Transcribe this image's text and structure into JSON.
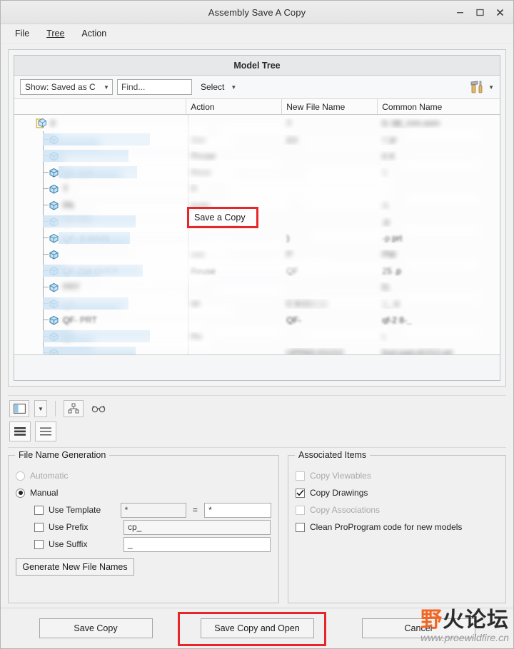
{
  "window": {
    "title": "Assembly Save A Copy",
    "controls": {
      "minimize": "minimize-icon",
      "maximize": "maximize-icon",
      "close": "close-icon"
    }
  },
  "menubar": {
    "items": [
      "File",
      "Tree",
      "Action"
    ]
  },
  "model_tree": {
    "header": "Model Tree",
    "toolbar": {
      "show_filter": "Show: Saved as C",
      "find_placeholder": "Find...",
      "select_label": "Select",
      "tools_icon": "hammer-screwdriver-icon"
    },
    "columns": [
      "",
      "Action",
      "New File Name",
      "Common Name"
    ],
    "rows": [
      {
        "name": "0",
        "action": "",
        "new_file_name": "2",
        "common_name": "0-  68_rnm.asm",
        "type": "assembly",
        "blurred": true
      },
      {
        "name": "",
        "action": "Sav",
        "new_file_name": "ZJ-",
        "common_name": "z      pr",
        "type": "part",
        "blurred": true
      },
      {
        "name": "",
        "action": "Reuse",
        "new_file_name": "",
        "common_name": "0          4",
        "type": "part",
        "blurred": true
      },
      {
        "name": "QF-  8-P",
        "action": "Reus",
        "new_file_name": "",
        "common_name": "1",
        "type": "part",
        "blurred": true
      },
      {
        "name": "T",
        "action": "R",
        "new_file_name": "",
        "common_name": "",
        "type": "part",
        "blurred": true
      },
      {
        "name": "PA",
        "action": "euse",
        "new_file_name": "",
        "common_name": "A",
        "type": "part",
        "blurred": true
      },
      {
        "name": "QF-255",
        "action": "Save a Copy",
        "new_file_name": "",
        "common_name": ".p",
        "type": "part",
        "blurred": true
      },
      {
        "name": "QF-  8-MAIN",
        "action": "",
        "new_file_name": ")",
        "common_name": "-p      prt",
        "type": "part",
        "blurred": false
      },
      {
        "name": "",
        "action": "use",
        "new_file_name": "P",
        "common_name": "PW",
        "type": "part",
        "blurred": true
      },
      {
        "name": "QF-258            OVER",
        "action": "Reuse",
        "new_file_name": "QF",
        "common_name": "25    .p",
        "type": "part",
        "blurred": false
      },
      {
        "name": "          PRT",
        "action": "",
        "new_file_name": "",
        "common_name": "D.",
        "type": "part",
        "blurred": true
      },
      {
        "name": "QF-",
        "action": "se",
        "new_file_name": "C   8-DECO",
        "common_name": "1_  rt",
        "type": "part",
        "blurred": true
      },
      {
        "name": "QF-             PRT",
        "action": "",
        "new_file_name": "QF-",
        "common_name": "qf-2  8-_",
        "type": "part",
        "blurred": false
      },
      {
        "name": "    QT-",
        "action": "Re",
        "new_file_name": "",
        "common_name": "t",
        "type": "part",
        "blurred": true
      },
      {
        "name": "",
        "action": "",
        "new_file_name": "UPPAD-D1212",
        "common_name": "foot-pad-d1212.prt",
        "type": "part",
        "blurred": true
      }
    ],
    "annotation": {
      "action_highlight": "Save a Copy"
    }
  },
  "view_toolbar": {
    "buttons": [
      {
        "name": "panel-layout-icon"
      },
      {
        "name": "panel-layout-dropdown"
      },
      {
        "name": "tree-structure-icon"
      },
      {
        "name": "glasses-icon"
      }
    ],
    "list_buttons": [
      {
        "name": "list-dense-icon"
      },
      {
        "name": "list-sparse-icon"
      }
    ]
  },
  "file_name_generation": {
    "legend": "File Name Generation",
    "automatic": {
      "label": "Automatic",
      "selected": false,
      "enabled": false
    },
    "manual": {
      "label": "Manual",
      "selected": true,
      "enabled": true
    },
    "use_template": {
      "label": "Use Template",
      "checked": false,
      "value_left": "*",
      "separator": "=",
      "value_right": "*"
    },
    "use_prefix": {
      "label": "Use Prefix",
      "checked": false,
      "value": "cp_"
    },
    "use_suffix": {
      "label": "Use Suffix",
      "checked": false,
      "value": "_"
    },
    "generate_button": "Generate New File Names"
  },
  "associated_items": {
    "legend": "Associated Items",
    "options": [
      {
        "label": "Copy Viewables",
        "checked": false,
        "enabled": false
      },
      {
        "label": "Copy Drawings",
        "checked": true,
        "enabled": true
      },
      {
        "label": "Copy Associations",
        "checked": false,
        "enabled": false
      },
      {
        "label": "Clean ProProgram code for new models",
        "checked": false,
        "enabled": true
      }
    ]
  },
  "footer": {
    "save_copy": "Save Copy",
    "save_copy_and_open": "Save Copy and Open",
    "cancel": "Cancel"
  },
  "watermark": {
    "text_orange": "野",
    "text_dark": "火论坛",
    "url": "www.proewildfire.cn"
  },
  "colors": {
    "annotation_red": "#e8262a",
    "watermark_orange": "#f26522",
    "window_bg": "#f0f0f0"
  }
}
